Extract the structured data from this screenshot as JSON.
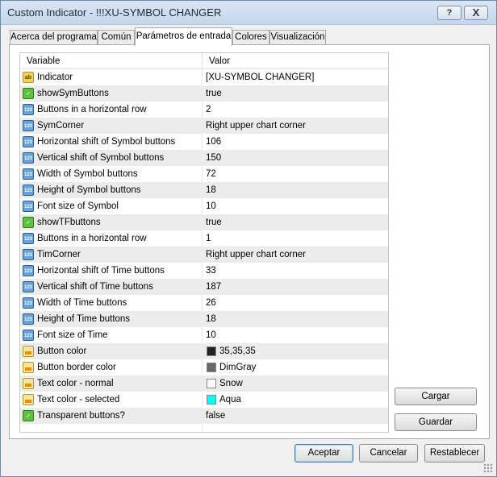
{
  "window": {
    "title": "Custom Indicator - !!!XU-SYMBOL CHANGER",
    "help_label": "?",
    "close_label": "X"
  },
  "tabs": [
    {
      "label": "Acerca del programa"
    },
    {
      "label": "Común"
    },
    {
      "label": "Parámetros de entrada"
    },
    {
      "label": "Colores"
    },
    {
      "label": "Visualización"
    }
  ],
  "active_tab": "Parámetros de entrada",
  "grid": {
    "header": {
      "variable": "Variable",
      "value": "Valor"
    },
    "rows": [
      {
        "icon": "string-icon",
        "name": "Indicator",
        "value": "[XU-SYMBOL CHANGER]"
      },
      {
        "icon": "bool-icon",
        "name": "showSymButtons",
        "value": "true"
      },
      {
        "icon": "int-icon",
        "name": "Buttons in a horizontal row",
        "value": "2"
      },
      {
        "icon": "int-icon",
        "name": "SymCorner",
        "value": "Right upper chart corner"
      },
      {
        "icon": "int-icon",
        "name": "Horizontal shift of Symbol buttons",
        "value": "106"
      },
      {
        "icon": "int-icon",
        "name": "Vertical shift of Symbol buttons",
        "value": "150"
      },
      {
        "icon": "int-icon",
        "name": "Width of Symbol buttons",
        "value": "72"
      },
      {
        "icon": "int-icon",
        "name": "Height of Symbol buttons",
        "value": "18"
      },
      {
        "icon": "int-icon",
        "name": "Font size of Symbol",
        "value": "10"
      },
      {
        "icon": "bool-icon",
        "name": "showTFbuttons",
        "value": "true"
      },
      {
        "icon": "int-icon",
        "name": "Buttons in a horizontal row",
        "value": "1"
      },
      {
        "icon": "int-icon",
        "name": "TimCorner",
        "value": "Right upper chart corner"
      },
      {
        "icon": "int-icon",
        "name": "Horizontal shift of Time buttons",
        "value": "33"
      },
      {
        "icon": "int-icon",
        "name": "Vertical shift of Time buttons",
        "value": "187"
      },
      {
        "icon": "int-icon",
        "name": "Width of Time buttons",
        "value": "26"
      },
      {
        "icon": "int-icon",
        "name": "Height of Time buttons",
        "value": "18"
      },
      {
        "icon": "int-icon",
        "name": "Font size of Time",
        "value": "10"
      },
      {
        "icon": "color-icon",
        "name": "Button color",
        "value": "35,35,35",
        "swatch": "#232323"
      },
      {
        "icon": "color-icon",
        "name": "Button border color",
        "value": "DimGray",
        "swatch": "#696969"
      },
      {
        "icon": "color-icon",
        "name": "Text color - normal",
        "value": "Snow",
        "swatch": "#fffafa"
      },
      {
        "icon": "color-icon",
        "name": "Text color - selected",
        "value": "Aqua",
        "swatch": "#00ffff"
      },
      {
        "icon": "bool-icon",
        "name": "Transparent buttons?",
        "value": "false"
      }
    ]
  },
  "side_buttons": {
    "load": "Cargar",
    "save": "Guardar"
  },
  "footer": {
    "accept": "Aceptar",
    "cancel": "Cancelar",
    "reset": "Restablecer"
  }
}
